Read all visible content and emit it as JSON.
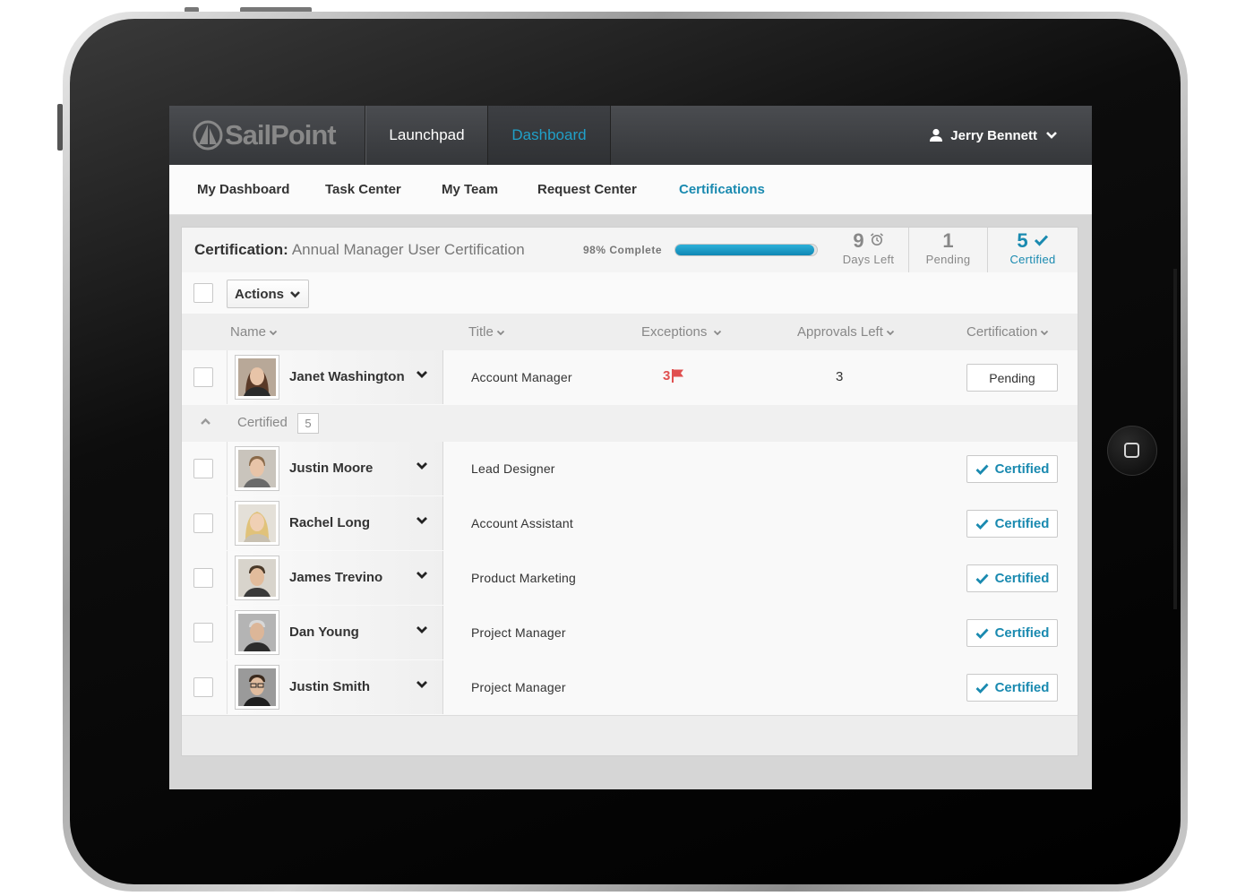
{
  "brand": {
    "name": "SailPoint"
  },
  "topnav": {
    "launchpad": "Launchpad",
    "dashboard": "Dashboard"
  },
  "user": {
    "name": "Jerry Bennett"
  },
  "subnav": [
    "My Dashboard",
    "Task Center",
    "My Team",
    "Request Center",
    "Certifications"
  ],
  "subnav_active": "Certifications",
  "certification": {
    "label": "Certification:",
    "name": "Annual Manager User Certification",
    "progress_label": "98% Complete",
    "progress_percent": 98,
    "days_left_value": "9",
    "days_left_caption": "Days Left",
    "pending_value": "1",
    "pending_caption": "Pending",
    "certified_value": "5",
    "certified_caption": "Certified"
  },
  "toolbar": {
    "actions_label": "Actions"
  },
  "columns": {
    "name": "Name",
    "title": "Title",
    "exceptions": "Exceptions",
    "approvals_left": "Approvals Left",
    "certification": "Certification"
  },
  "pending_rows": [
    {
      "name": "Janet Washington",
      "title": "Account Manager",
      "exceptions": "3",
      "approvals_left": "3",
      "status": "Pending"
    }
  ],
  "certified_group": {
    "label": "Certified",
    "count": "5",
    "rows": [
      {
        "name": "Justin Moore",
        "title": "Lead Designer",
        "status": "Certified"
      },
      {
        "name": "Rachel Long",
        "title": "Account Assistant",
        "status": "Certified"
      },
      {
        "name": "James Trevino",
        "title": "Product Marketing",
        "status": "Certified"
      },
      {
        "name": "Dan Young",
        "title": "Project Manager",
        "status": "Certified"
      },
      {
        "name": "Justin Smith",
        "title": "Project Manager",
        "status": "Certified"
      }
    ]
  },
  "colors": {
    "accent": "#1a8ab0",
    "dashboard_link": "#20a0c8",
    "topbar": "#3d3f43",
    "exception_red": "#e05050",
    "progress_fill": "#1b9cc8"
  }
}
